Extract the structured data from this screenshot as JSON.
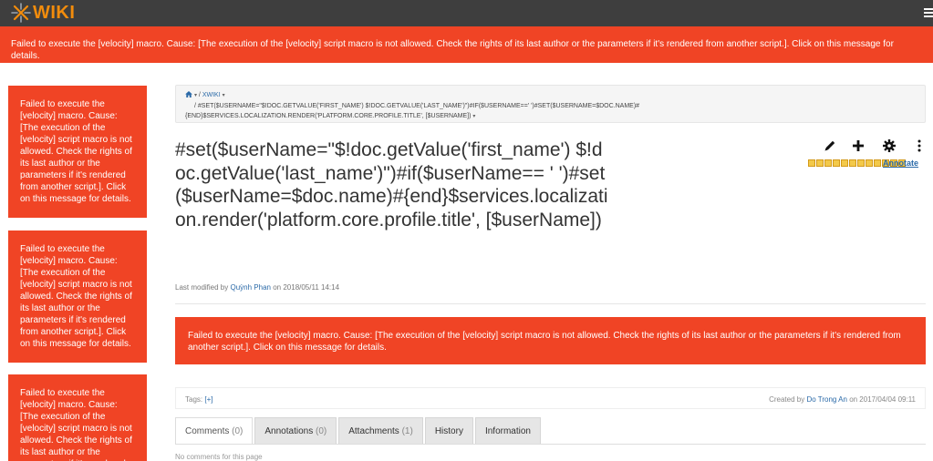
{
  "brand": {
    "name": "WIKI",
    "accent": "#f28c0c"
  },
  "topbar": {
    "menu_icon": "hamburger-icon"
  },
  "error": {
    "message": "Failed to execute the [velocity] macro. Cause: [The execution of the [velocity] script macro is not allowed. Check the rights of its last author or the parameters if it's rendered from another script.]. Click on this message for details.",
    "color": "#f04425"
  },
  "breadcrumb": {
    "separator": "/",
    "root": "XWIKI",
    "line2": "#SET($USERNAME=\"$!DOC.GETVALUE('FIRST_NAME') $!DOC.GETVALUE('LAST_NAME')\")#IF($USERNAME==' ')#SET($USERNAME=$DOC.NAME)#",
    "line3": "{END}$SERVICES.LOCALIZATION.RENDER('PLATFORM.CORE.PROFILE.TITLE', [$USERNAME])"
  },
  "page": {
    "title": "#set($userName=\"$!doc.getValue('first_name') $!doc.getValue('last_name')\")#if($userName== ' ')#set($userName=$doc.name)#{end}$services.localization.render('platform.core.profile.title', [$userName])",
    "last_modified_prefix": "Last modified by",
    "last_modified_user": "Quỳnh Phan",
    "last_modified_date": "on 2018/05/11 14:14"
  },
  "actions": {
    "edit_icon": "pencil-icon",
    "add_icon": "plus-icon",
    "settings_icon": "gear-icon",
    "more_icon": "vertical-dots-icon",
    "annotate_label": "Annotate"
  },
  "tags": {
    "label": "Tags:",
    "add": "[+]"
  },
  "created": {
    "prefix": "Created by",
    "user": "Do Trong An",
    "date": "on 2017/04/04 09:11"
  },
  "tabs": [
    {
      "label": "Comments",
      "count": "(0)"
    },
    {
      "label": "Annotations",
      "count": "(0)"
    },
    {
      "label": "Attachments",
      "count": "(1)"
    },
    {
      "label": "History",
      "count": ""
    },
    {
      "label": "Information",
      "count": ""
    }
  ],
  "comments": {
    "empty_text": "No comments for this page"
  }
}
